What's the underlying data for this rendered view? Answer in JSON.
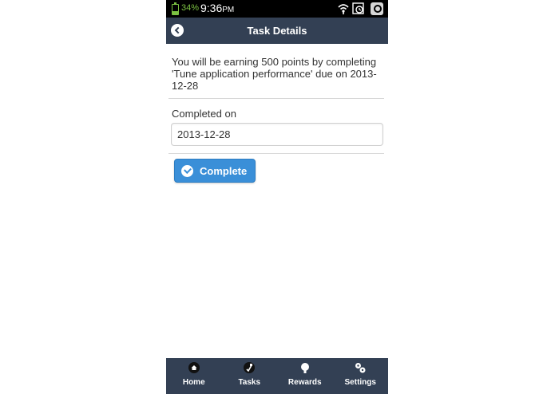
{
  "status_bar": {
    "battery_percent": "34%",
    "battery_level": 0.34,
    "time": "9:36",
    "ampm": "PM",
    "icons": [
      "battery-icon",
      "wifi-icon",
      "sync-icon",
      "app-icon"
    ]
  },
  "header": {
    "title": "Task Details",
    "back_icon": "back-arrow-icon"
  },
  "content": {
    "message": "You will be earning 500 points by completing 'Tune application performance' due on 2013-12-28",
    "completed_label": "Completed on",
    "completed_value": "2013-12-28",
    "complete_button_label": "Complete",
    "complete_icon": "check-circle-icon"
  },
  "bottom_nav": {
    "items": [
      {
        "label": "Home",
        "icon": "home-icon"
      },
      {
        "label": "Tasks",
        "icon": "tasks-icon"
      },
      {
        "label": "Rewards",
        "icon": "rewards-icon"
      },
      {
        "label": "Settings",
        "icon": "settings-icon"
      }
    ]
  },
  "colors": {
    "header_bg": "#334054",
    "status_bg": "#000000",
    "battery_green": "#7cc242",
    "button_blue": "#3a8fd8"
  }
}
